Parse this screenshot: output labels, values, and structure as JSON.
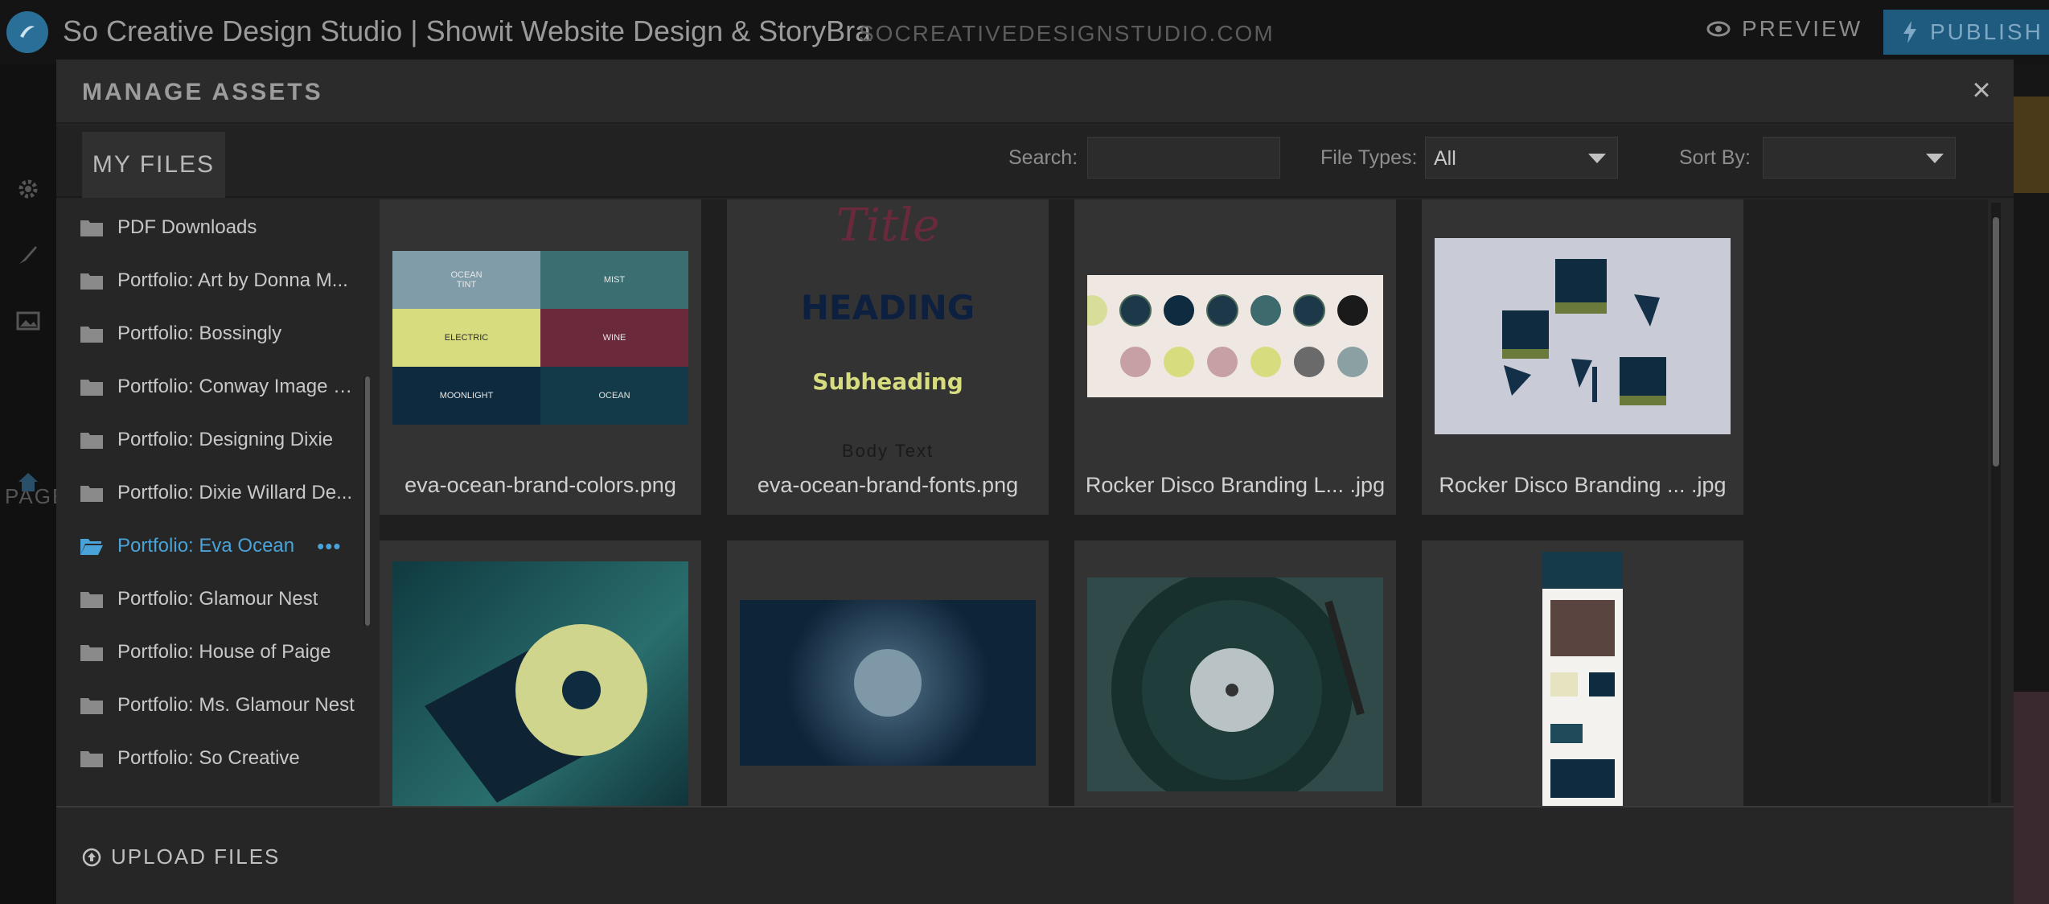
{
  "app": {
    "site_title": "So Creative Design Studio | Showit Website Design & StoryBra",
    "site_domain": "SOCREATIVEDESIGNSTUDIO.COM",
    "preview_label": "PREVIEW",
    "publish_label": "PUBLISH",
    "bg_pages_label": "PAGE",
    "accent_color": "#4aa3d8"
  },
  "modal": {
    "title": "MANAGE ASSETS",
    "close_label": "×",
    "tab_label": "MY FILES",
    "search_label": "Search:",
    "search_value": "",
    "file_types_label": "File Types:",
    "file_types_value": "All",
    "sort_by_label": "Sort By:",
    "sort_by_value": ""
  },
  "folders": [
    {
      "label": "PDF Downloads",
      "active": false
    },
    {
      "label": "Portfolio: Art by Donna M...",
      "active": false
    },
    {
      "label": "Portfolio: Bossingly",
      "active": false
    },
    {
      "label": "Portfolio: Conway Image C...",
      "active": false
    },
    {
      "label": "Portfolio: Designing Dixie",
      "active": false
    },
    {
      "label": "Portfolio: Dixie Willard De...",
      "active": false
    },
    {
      "label": "Portfolio: Eva Ocean",
      "active": true
    },
    {
      "label": "Portfolio: Glamour Nest",
      "active": false
    },
    {
      "label": "Portfolio: House of Paige",
      "active": false
    },
    {
      "label": "Portfolio: Ms. Glamour Nest",
      "active": false
    },
    {
      "label": "Portfolio: So Creative",
      "active": false
    }
  ],
  "folder_more_label": "•••",
  "assets": [
    {
      "name": "eva-ocean-brand-colors.png"
    },
    {
      "name": "eva-ocean-brand-fonts.png"
    },
    {
      "name": "Rocker Disco Branding L... .jpg"
    },
    {
      "name": "Rocker Disco Branding ... .jpg"
    },
    {
      "name": ""
    },
    {
      "name": ""
    },
    {
      "name": ""
    },
    {
      "name": ""
    }
  ],
  "swatches": [
    {
      "label": "OCEAN\nTINT",
      "color": "#7f9ca8"
    },
    {
      "label": "MIST",
      "color": "#3a6e70"
    },
    {
      "label": "ELECTRIC",
      "color": "#d7dd7e"
    },
    {
      "label": "WINE",
      "color": "#6a2a3c"
    },
    {
      "label": "MOONLIGHT",
      "color": "#0e2a3e"
    },
    {
      "label": "OCEAN",
      "color": "#133a48"
    }
  ],
  "fonts_preview": {
    "title": "Title",
    "heading": "HEADING",
    "subheading": "Subheading",
    "body": "Body Text"
  },
  "footer": {
    "upload_label": "UPLOAD FILES"
  }
}
